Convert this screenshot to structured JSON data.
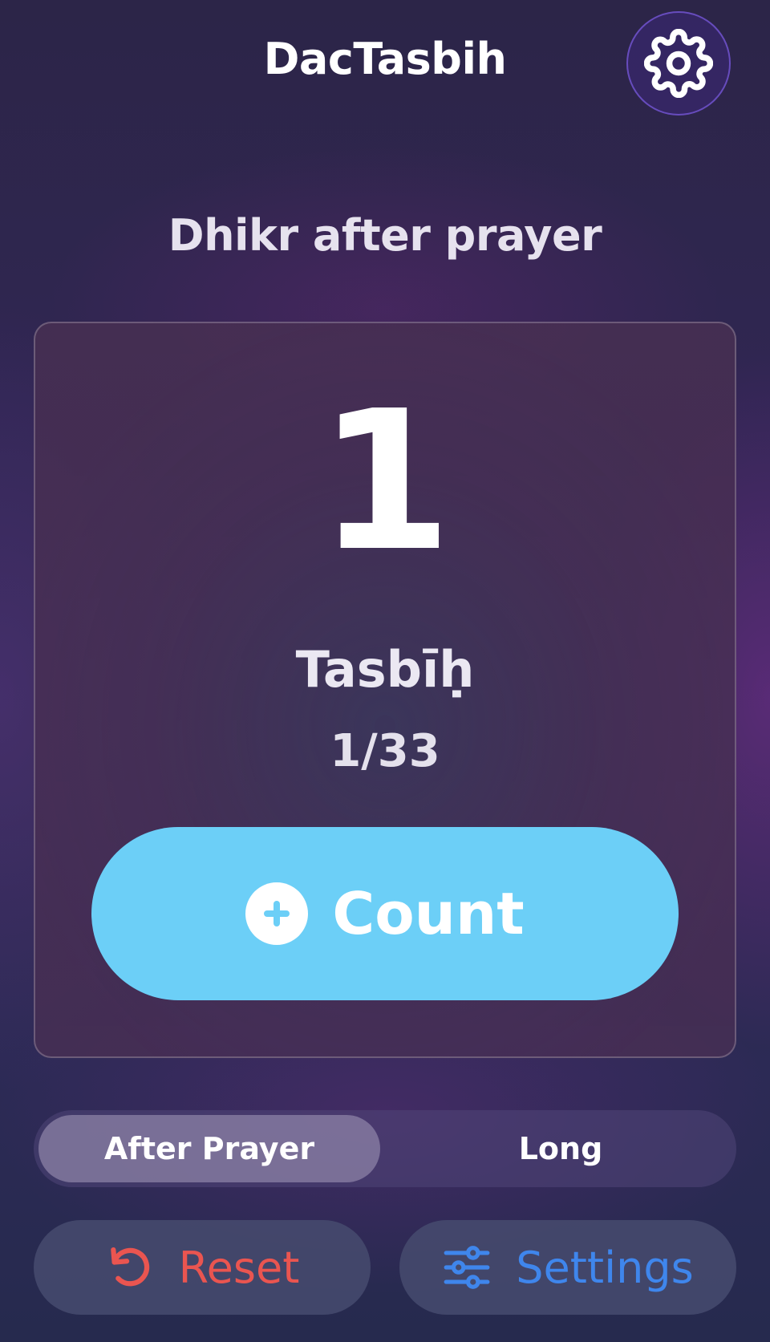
{
  "header": {
    "title": "DacTasbih",
    "settings_icon": "gear-icon"
  },
  "section": {
    "title": "Dhikr after prayer"
  },
  "counter": {
    "value": "1",
    "dhikr_name": "Tasbīḥ",
    "progress": "1/33",
    "count_button_label": "Count",
    "count_button_icon": "plus-circle-icon",
    "count_button_color": "#6ccff7"
  },
  "mode_selector": {
    "options": [
      {
        "label": "After Prayer",
        "selected": true
      },
      {
        "label": "Long",
        "selected": false
      }
    ]
  },
  "actions": {
    "reset": {
      "label": "Reset",
      "icon": "rotate-ccw-icon",
      "color": "#ea5550"
    },
    "settings": {
      "label": "Settings",
      "icon": "sliders-icon",
      "color": "#3f86ec"
    }
  }
}
